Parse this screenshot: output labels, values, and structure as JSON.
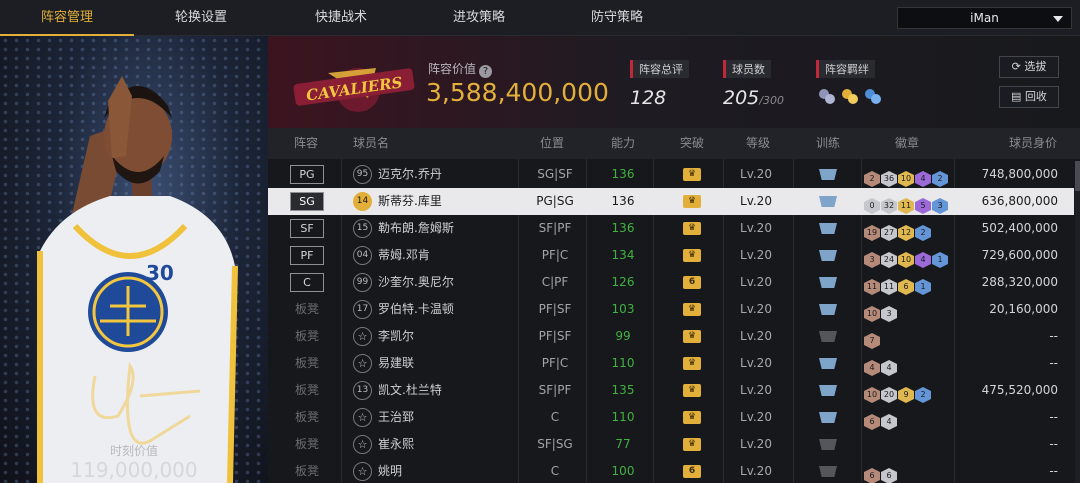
{
  "nav": {
    "tabs": [
      "阵容管理",
      "轮换设置",
      "快捷战术",
      "进攻策略",
      "防守策略"
    ],
    "active_index": 0,
    "user": "iMan"
  },
  "hero": {
    "value_label": "时刻价值",
    "value": "119,000,000",
    "jersey_number": "30"
  },
  "header": {
    "value_label": "阵容价值",
    "value": "3,588,400,000",
    "team_logo_text": "CAVALIERS",
    "rating_label": "阵容总评",
    "rating": "128",
    "players_label": "球员数",
    "players": "205",
    "players_max": "/300",
    "bond_label": "阵容羁绊",
    "pick_label": "选拔",
    "recycle_label": "回收"
  },
  "table": {
    "headers": [
      "阵容",
      "球员名",
      "位置",
      "能力",
      "突破",
      "等级",
      "训练",
      "徽章",
      "球员身价"
    ],
    "rows": [
      {
        "slot": "PG",
        "bench": false,
        "num": "95",
        "name": "迈克尔.乔丹",
        "pos": "SG|SF",
        "ability": "136",
        "break_icon": "crown",
        "level": "Lv.20",
        "train_dim": false,
        "medals": [
          [
            "m-bronze",
            "2"
          ],
          [
            "m-silver",
            "36"
          ],
          [
            "m-gold",
            "10"
          ],
          [
            "m-purple",
            "4"
          ],
          [
            "m-blue",
            "2"
          ]
        ],
        "salary": "748,800,000",
        "selected": false
      },
      {
        "slot": "SG",
        "bench": false,
        "num": "14",
        "num_gold": true,
        "name": "斯蒂芬.库里",
        "pos": "PG|SG",
        "ability": "136",
        "break_icon": "crown",
        "level": "Lv.20",
        "train_dim": false,
        "medals": [
          [
            "m-silver",
            "0"
          ],
          [
            "m-silver",
            "32"
          ],
          [
            "m-gold",
            "11"
          ],
          [
            "m-purple",
            "5"
          ],
          [
            "m-blue",
            "3"
          ]
        ],
        "salary": "636,800,000",
        "selected": true
      },
      {
        "slot": "SF",
        "bench": false,
        "num": "15",
        "name": "勒布朗.詹姆斯",
        "pos": "SF|PF",
        "ability": "136",
        "break_icon": "crown",
        "level": "Lv.20",
        "train_dim": false,
        "medals": [
          [
            "m-bronze",
            "19"
          ],
          [
            "m-silver",
            "27"
          ],
          [
            "m-gold",
            "12"
          ],
          [
            "m-blue",
            "2"
          ]
        ],
        "salary": "502,400,000",
        "selected": false
      },
      {
        "slot": "PF",
        "bench": false,
        "num": "04",
        "name": "蒂姆.邓肯",
        "pos": "PF|C",
        "ability": "134",
        "break_icon": "crown",
        "level": "Lv.20",
        "train_dim": false,
        "medals": [
          [
            "m-bronze",
            "3"
          ],
          [
            "m-silver",
            "24"
          ],
          [
            "m-gold",
            "10"
          ],
          [
            "m-purple",
            "4"
          ],
          [
            "m-blue",
            "1"
          ]
        ],
        "salary": "729,600,000",
        "selected": false
      },
      {
        "slot": "C",
        "bench": false,
        "num": "99",
        "name": "沙奎尔.奥尼尔",
        "pos": "C|PF",
        "ability": "126",
        "break_icon": "6",
        "level": "Lv.20",
        "train_dim": false,
        "medals": [
          [
            "m-bronze",
            "11"
          ],
          [
            "m-silver",
            "11"
          ],
          [
            "m-gold",
            "6"
          ],
          [
            "m-blue",
            "1"
          ]
        ],
        "salary": "288,320,000",
        "selected": false
      },
      {
        "slot": "板凳",
        "bench": true,
        "num": "17",
        "name": "罗伯特.卡温顿",
        "pos": "PF|SF",
        "ability": "103",
        "break_icon": "crown",
        "level": "Lv.20",
        "train_dim": false,
        "medals": [
          [
            "m-bronze",
            "10"
          ],
          [
            "m-silver",
            "3"
          ]
        ],
        "salary": "20,160,000",
        "selected": false
      },
      {
        "slot": "板凳",
        "bench": true,
        "num": "☆",
        "star": true,
        "name": "李凯尔",
        "pos": "PF|SF",
        "ability": "99",
        "break_icon": "crown",
        "level": "Lv.20",
        "train_dim": true,
        "medals": [
          [
            "m-bronze",
            "7"
          ]
        ],
        "salary": "--",
        "selected": false
      },
      {
        "slot": "板凳",
        "bench": true,
        "num": "☆",
        "star": true,
        "name": "易建联",
        "pos": "PF|C",
        "ability": "110",
        "break_icon": "crown",
        "level": "Lv.20",
        "train_dim": false,
        "medals": [
          [
            "m-bronze",
            "4"
          ],
          [
            "m-silver",
            "4"
          ]
        ],
        "salary": "--",
        "selected": false
      },
      {
        "slot": "板凳",
        "bench": true,
        "num": "13",
        "name": "凯文.杜兰特",
        "pos": "SF|PF",
        "ability": "135",
        "break_icon": "crown",
        "level": "Lv.20",
        "train_dim": false,
        "medals": [
          [
            "m-bronze",
            "10"
          ],
          [
            "m-silver",
            "20"
          ],
          [
            "m-gold",
            "9"
          ],
          [
            "m-blue",
            "2"
          ]
        ],
        "salary": "475,520,000",
        "selected": false
      },
      {
        "slot": "板凳",
        "bench": true,
        "num": "☆",
        "star": true,
        "name": "王治郅",
        "pos": "C",
        "ability": "110",
        "break_icon": "crown",
        "level": "Lv.20",
        "train_dim": false,
        "medals": [
          [
            "m-bronze",
            "6"
          ],
          [
            "m-silver",
            "4"
          ]
        ],
        "salary": "--",
        "selected": false
      },
      {
        "slot": "板凳",
        "bench": true,
        "num": "☆",
        "star": true,
        "name": "崔永熙",
        "pos": "SF|SG",
        "ability": "77",
        "break_icon": "crown",
        "level": "Lv.20",
        "train_dim": true,
        "medals": [],
        "salary": "--",
        "selected": false
      },
      {
        "slot": "板凳",
        "bench": true,
        "num": "☆",
        "star": true,
        "name": "姚明",
        "pos": "C",
        "ability": "100",
        "break_icon": "6",
        "level": "Lv.20",
        "train_dim": true,
        "medals": [
          [
            "m-bronze",
            "6"
          ],
          [
            "m-silver",
            "6"
          ]
        ],
        "salary": "--",
        "selected": false
      }
    ]
  },
  "colors": {
    "accent": "#e2b03a",
    "ability": "#41b141",
    "team": "#6e1a2e"
  }
}
